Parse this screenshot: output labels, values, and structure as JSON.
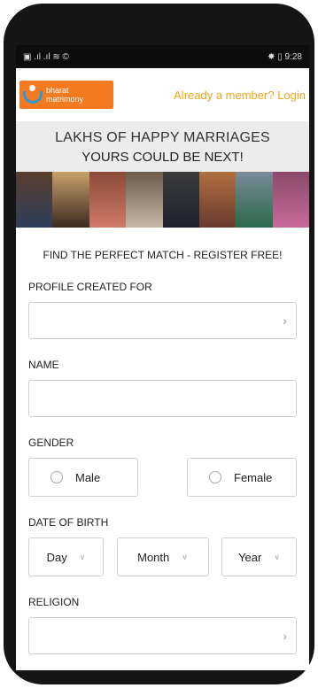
{
  "status_bar": {
    "left": "▣ .ıl .ıl ≋ ©",
    "right": "✸ ▯ 9:28",
    "time": "9:28"
  },
  "header": {
    "logo_line1": "bharat",
    "logo_line2": "matrimony",
    "login_text": "Already a member? Login"
  },
  "banner": {
    "line1": "LAKHS OF HAPPY MARRIAGES",
    "line2": "YOURS COULD BE NEXT!"
  },
  "form": {
    "title": "FIND THE PERFECT MATCH - REGISTER FREE!",
    "profile_created_for": {
      "label": "PROFILE CREATED FOR",
      "value": ""
    },
    "name": {
      "label": "NAME",
      "value": ""
    },
    "gender": {
      "label": "GENDER",
      "options": [
        "Male",
        "Female"
      ]
    },
    "dob": {
      "label": "DATE OF BIRTH",
      "day": "Day",
      "month": "Month",
      "year": "Year"
    },
    "religion": {
      "label": "RELIGION",
      "value": ""
    }
  },
  "colors": {
    "brand_orange": "#f37a21",
    "login_color": "#f0a41a",
    "logo_blue": "#2a9ad6"
  }
}
